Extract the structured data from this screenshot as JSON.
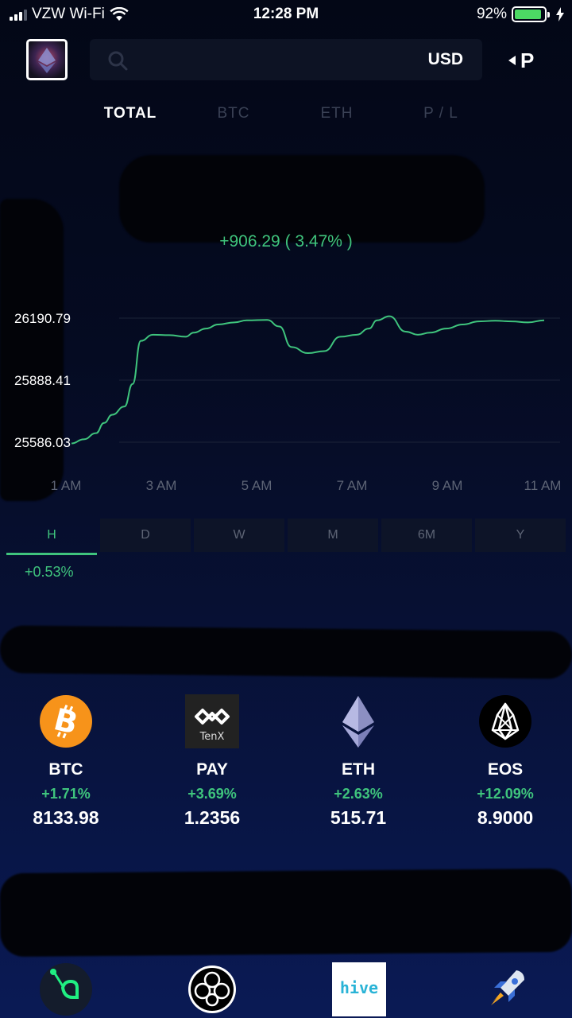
{
  "status": {
    "carrier": "VZW Wi-Fi",
    "time": "12:28 PM",
    "battery": "92%",
    "battery_level": 0.92
  },
  "header": {
    "currency": "USD",
    "p_label": "P",
    "avatar_icon": "ethereum-avatar-icon",
    "search_icon": "search-icon"
  },
  "tabs": [
    "TOTAL",
    "BTC",
    "ETH",
    "P / L"
  ],
  "summary": {
    "change": "+906.29 ( 3.47% )"
  },
  "chart_data": {
    "type": "line",
    "color": "#3fc47d",
    "y_ticks": [
      "26190.79",
      "25888.41",
      "25586.03"
    ],
    "x_ticks": [
      "1 AM",
      "3 AM",
      "5 AM",
      "7 AM",
      "9 AM",
      "11 AM"
    ],
    "x": [
      0.0,
      0.3,
      0.6,
      0.8,
      1.0,
      1.3,
      1.5,
      1.7,
      2.0,
      2.4,
      2.8,
      3.0,
      3.3,
      3.6,
      4.0,
      4.3,
      4.8,
      5.1,
      5.4,
      5.8,
      6.2,
      6.6,
      7.0,
      7.3,
      7.5,
      7.8,
      8.2,
      8.5,
      8.8,
      9.2,
      9.6,
      10.0,
      10.4,
      10.8,
      11.2,
      11.6
    ],
    "y": [
      25580,
      25600,
      25630,
      25680,
      25720,
      25760,
      25870,
      26080,
      26110,
      26108,
      26100,
      26120,
      26140,
      26160,
      26170,
      26180,
      26182,
      26150,
      26050,
      26020,
      26030,
      26100,
      26110,
      26140,
      26180,
      26200,
      26125,
      26110,
      26120,
      26140,
      26160,
      26175,
      26178,
      26175,
      26170,
      26180
    ],
    "ylim": [
      25560,
      26240
    ]
  },
  "periods": [
    "H",
    "D",
    "W",
    "M",
    "6M",
    "Y"
  ],
  "period_change": "+0.53%",
  "coins": [
    {
      "sym": "BTC",
      "chg": "+1.71%",
      "price": "8133.98",
      "icon": "bitcoin-icon",
      "color": "#f7931a"
    },
    {
      "sym": "PAY",
      "chg": "+3.69%",
      "price": "1.2356",
      "icon": "tenx-icon",
      "brand": "TenX"
    },
    {
      "sym": "ETH",
      "chg": "+2.63%",
      "price": "515.71",
      "icon": "ethereum-icon"
    },
    {
      "sym": "EOS",
      "chg": "+12.09%",
      "price": "8.9000",
      "icon": "eos-icon"
    }
  ],
  "bottom_icons": [
    "siacoin-icon",
    "aion-icon",
    "hive-icon",
    "stellar-rocket-icon"
  ],
  "hive_label": "hive"
}
